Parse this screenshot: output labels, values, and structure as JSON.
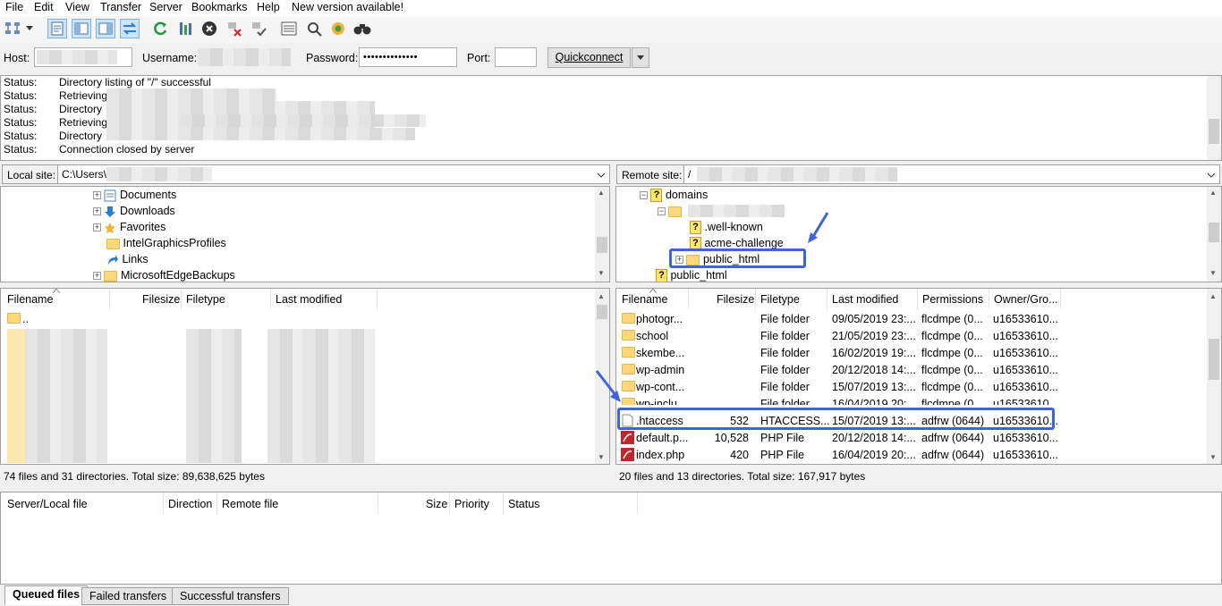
{
  "menu": [
    "File",
    "Edit",
    "View",
    "Transfer",
    "Server",
    "Bookmarks",
    "Help",
    "New version available!"
  ],
  "toolbar_icons": [
    "site-manager-icon",
    "dropdown-arrow-icon",
    "toggle-log-icon",
    "toggle-local-tree-icon",
    "toggle-remote-tree-icon",
    "toggle-queue-icon",
    "refresh-icon",
    "process-queue-icon",
    "cancel-icon",
    "disconnect-icon",
    "reconnect-icon",
    "filter-icon",
    "compare-icon",
    "sync-browse-icon",
    "search-icon"
  ],
  "quickconnect": {
    "host_label": "Host:",
    "username_label": "Username:",
    "password_label": "Password:",
    "password_value": "••••••••••••••",
    "port_label": "Port:",
    "button": "Quickconnect"
  },
  "log": [
    {
      "k": "Status:",
      "v": "Directory listing of \"/\" successful"
    },
    {
      "k": "Status:",
      "v": "Retrieving"
    },
    {
      "k": "Status:",
      "v": "Directory"
    },
    {
      "k": "Status:",
      "v": "Retrieving"
    },
    {
      "k": "Status:",
      "v": "Directory"
    },
    {
      "k": "Status:",
      "v": "Connection closed by server"
    }
  ],
  "local": {
    "site_label": "Local site:",
    "path": "C:\\Users\\",
    "tree": [
      "Documents",
      "Downloads",
      "Favorites",
      "IntelGraphicsProfiles",
      "Links",
      "MicrosoftEdgeBackups"
    ],
    "columns": [
      "Filename",
      "Filesize",
      "Filetype",
      "Last modified"
    ],
    "parent_dir": "..",
    "status": "74 files and 31 directories. Total size: 89,638,625 bytes"
  },
  "remote": {
    "site_label": "Remote site:",
    "path": "/",
    "tree": [
      "domains",
      ".well-known",
      "acme-challenge",
      "public_html",
      "public_html"
    ],
    "columns": [
      "Filename",
      "Filesize",
      "Filetype",
      "Last modified",
      "Permissions",
      "Owner/Gro..."
    ],
    "files": [
      {
        "name": "photogr...",
        "size": "",
        "type": "File folder",
        "modified": "09/05/2019 23:...",
        "perm": "flcdmpe (0...",
        "owner": "u16533610..."
      },
      {
        "name": "school",
        "size": "",
        "type": "File folder",
        "modified": "21/05/2019 23:...",
        "perm": "flcdmpe (0...",
        "owner": "u16533610..."
      },
      {
        "name": "skembe...",
        "size": "",
        "type": "File folder",
        "modified": "16/02/2019 19:...",
        "perm": "flcdmpe (0...",
        "owner": "u16533610..."
      },
      {
        "name": "wp-admin",
        "size": "",
        "type": "File folder",
        "modified": "20/12/2018 14:...",
        "perm": "flcdmpe (0...",
        "owner": "u16533610..."
      },
      {
        "name": "wp-cont...",
        "size": "",
        "type": "File folder",
        "modified": "15/07/2019 13:...",
        "perm": "flcdmpe (0...",
        "owner": "u16533610..."
      },
      {
        "name": "wp-inclu...",
        "size": "",
        "type": "File folder",
        "modified": "16/04/2019 20:...",
        "perm": "flcdmpe (0...",
        "owner": "u16533610..."
      },
      {
        "name": ".htaccess",
        "size": "532",
        "type": "HTACCESS...",
        "modified": "15/07/2019 13:...",
        "perm": "adfrw (0644)",
        "owner": "u16533610..."
      },
      {
        "name": "default.p...",
        "size": "10,528",
        "type": "PHP File",
        "modified": "20/12/2018 14:...",
        "perm": "adfrw (0644)",
        "owner": "u16533610..."
      },
      {
        "name": "index.php",
        "size": "420",
        "type": "PHP File",
        "modified": "16/04/2019 20:...",
        "perm": "adfrw (0644)",
        "owner": "u16533610..."
      }
    ],
    "status": "20 files and 13 directories. Total size: 167,917 bytes"
  },
  "queue": {
    "columns": [
      "Server/Local file",
      "Direction",
      "Remote file",
      "Size",
      "Priority",
      "Status"
    ],
    "tabs": [
      "Queued files",
      "Failed transfers",
      "Successful transfers"
    ]
  },
  "colors": {
    "highlight": "#3e63dd",
    "folder": "#fcd87a"
  }
}
